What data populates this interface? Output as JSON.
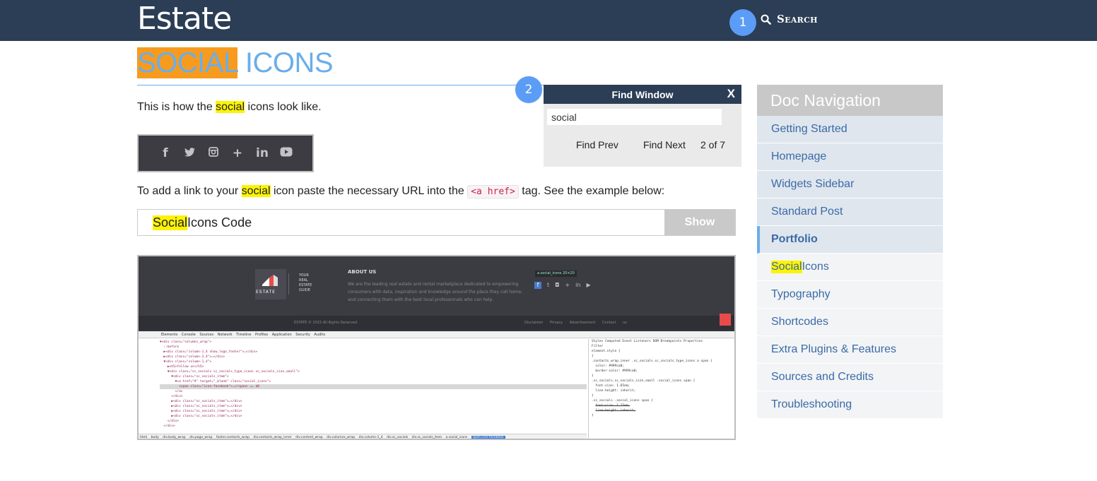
{
  "header": {
    "brand": "Estate",
    "search_label": "Search",
    "marker1": "1"
  },
  "page": {
    "title_highlight": "SOCIAL",
    "title_rest": " ICONS",
    "marker2": "2",
    "para1_before": "This is how the ",
    "para1_hl": "social",
    "para1_after": " icons look like.",
    "social_icons": [
      "f",
      "t",
      "ig",
      "+",
      "in",
      "yt"
    ],
    "para2_before": "To add a link to your ",
    "para2_hl": "social",
    "para2_mid": " icon paste the necessary URL into the ",
    "para2_code": "<a href>",
    "para2_after": " tag. See the example below:",
    "accordion_hl": "Social",
    "accordion_rest": " Icons Code",
    "accordion_button": "Show"
  },
  "screenshot": {
    "logo_text": "ESTATE",
    "logo_tag": "YOUR REAL ESTATE GUIDE",
    "about_heading": "ABOUT US",
    "about_text": "We are the leading real estate and rental marketplace dedicated to empowering consumers with data, inspiration and knowledge around the place they call home, and connecting them with the best local professionals who can help.",
    "tooltip": "a.social_icons  20×20",
    "copyright": "ESTATE © 2015 All Rights Reserved",
    "footer_links": "Disclaimer Privacy Advertisement Contact us",
    "devtools_tabs": "Elements Console Sources Network Timeline Profiles Application Security Audits",
    "styles_tabs": "Styles Computed Event Listeners DOM Breakpoints Properties"
  },
  "find": {
    "title": "Find Window",
    "close": "X",
    "query": "social",
    "prev": "Find Prev",
    "next": "Find Next",
    "count": "2 of 7"
  },
  "docnav": {
    "heading": "Doc Navigation",
    "items": [
      {
        "label": "Getting Started"
      },
      {
        "label": "Homepage"
      },
      {
        "label": "Widgets Sidebar"
      },
      {
        "label": "Standard Post"
      },
      {
        "label": "Portfolio"
      },
      {
        "label_hl": "Social",
        "label_rest": " Icons"
      },
      {
        "label": "Typography"
      },
      {
        "label": "Shortcodes"
      },
      {
        "label": "Extra Plugins & Features"
      },
      {
        "label": "Sources and Credits"
      },
      {
        "label": "Troubleshooting"
      }
    ]
  },
  "colors": {
    "header_bg": "#2c3e55",
    "accent": "#6aaeea",
    "highlight": "#fcf305",
    "title_highlight": "#f79b1e",
    "marker": "#5b9cf6"
  }
}
